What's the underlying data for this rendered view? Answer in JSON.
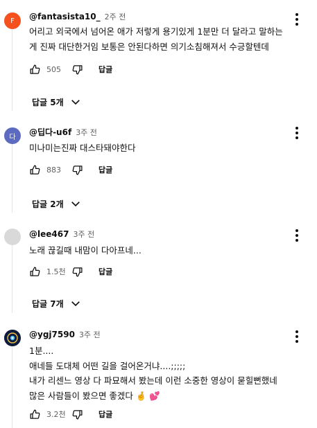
{
  "comments": [
    {
      "avatar_letter": "F",
      "avatar_color": "#f4511e",
      "handle": "@fantasista10_",
      "time": "2주 전",
      "lines": [
        "어리고 외국에서 넘어온 애가 저렇게 용기있게 1분만 더 달라고 말하는",
        "게 진짜 대단한거임 보통은 안된다하면 의기소침해져서 수긍할텐데"
      ],
      "likes": "505",
      "reply_label": "답글",
      "replies_label": "답글 5개"
    },
    {
      "avatar_letter": "다",
      "avatar_color": "#5c6bc0",
      "handle": "@딥다-u6f",
      "time": "3주 전",
      "lines": [
        "미나미는진짜 대스타돼야한다"
      ],
      "likes": "883",
      "reply_label": "답글",
      "replies_label": "답글 2개"
    },
    {
      "avatar_letter": "",
      "avatar_color": "#d9d9d9",
      "handle": "@lee467",
      "time": "3주 전",
      "lines": [
        "노래 끊길때 내맘이 다아프네..."
      ],
      "likes": "1.5천",
      "reply_label": "답글",
      "replies_label": "답글 7개"
    },
    {
      "avatar_letter": "",
      "avatar_color": "#0d1b3e",
      "handle": "@ygj7590",
      "time": "3주 전",
      "lines": [
        "1분....",
        "애네들 도대체 어떤 길을 걸어온거냐....;;;;;",
        "내가 리센느 영상 다 파묘해서 봤는데 이런 소중한 영상이 묻힐뻔했네",
        "많은 사람들이 봤으면 좋겠다 🤞 💕"
      ],
      "likes": "3.2천",
      "reply_label": "답글"
    }
  ]
}
